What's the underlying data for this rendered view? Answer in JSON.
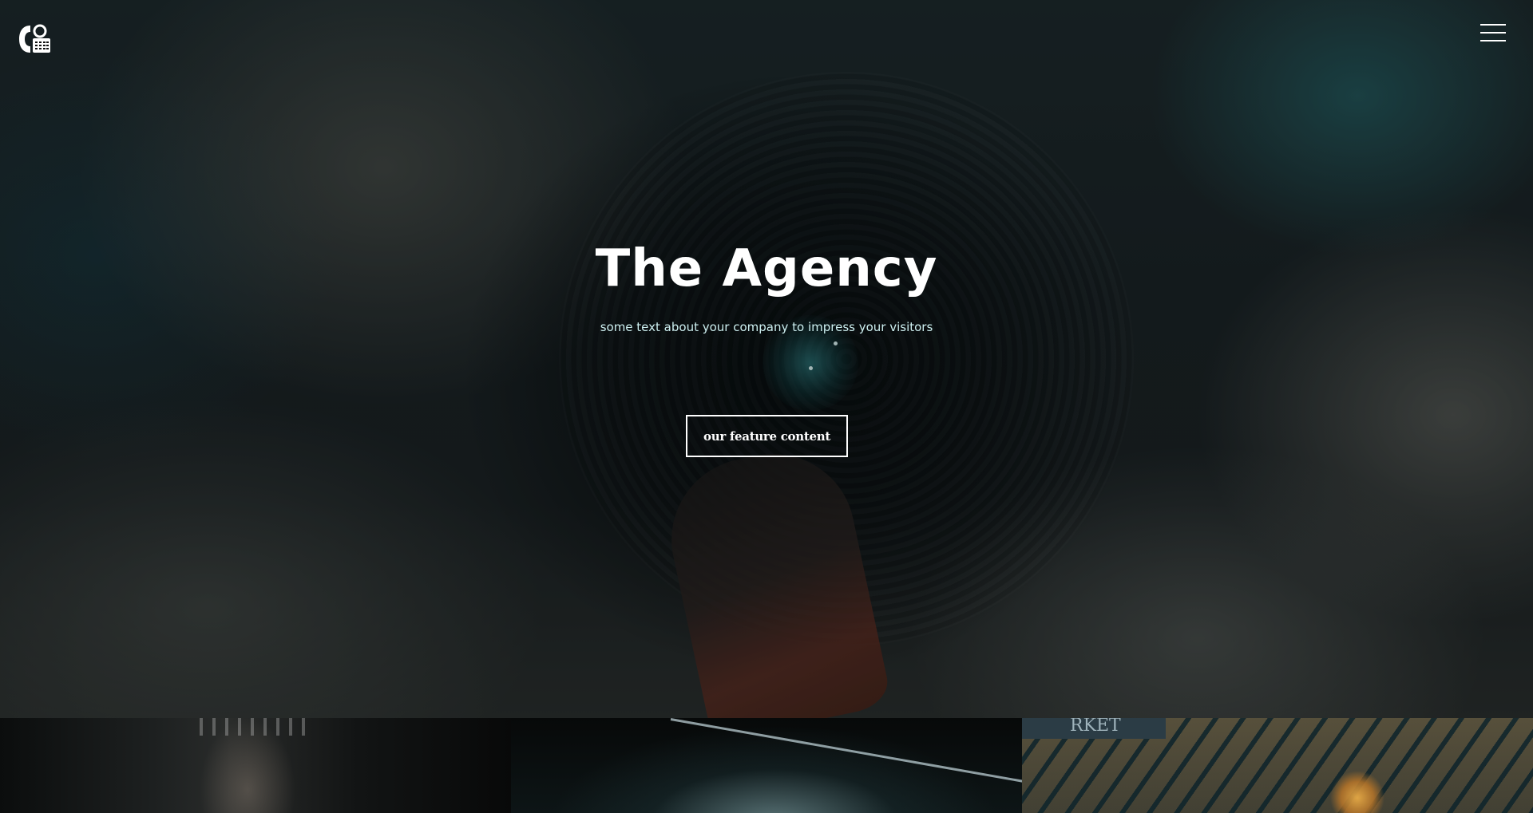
{
  "header": {
    "logo_icon": "typewriter-person-logo",
    "menu_icon": "hamburger-menu-icon"
  },
  "hero": {
    "title": "The Agency",
    "subtitle": "some text about your company to impress your visitors",
    "cta_label": "our feature content"
  },
  "tiles": [
    {
      "name": "tile-woman-dark-room"
    },
    {
      "name": "tile-misty-blue"
    },
    {
      "name": "tile-market-station",
      "sign_text": "RKET"
    }
  ],
  "colors": {
    "accent_teal": "#cdeff0",
    "background": "#050708",
    "button_border": "#ffffff"
  }
}
